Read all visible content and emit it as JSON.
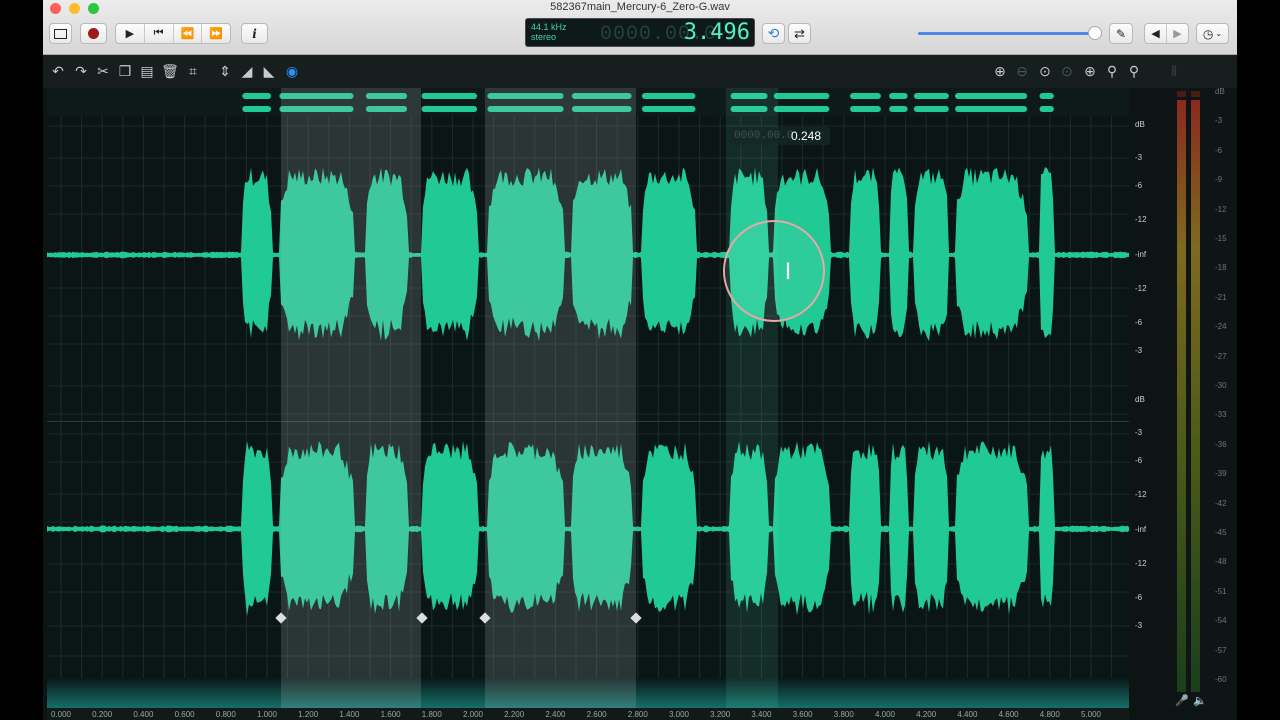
{
  "window": {
    "title": "582367main_Mercury-6_Zero-G.wav"
  },
  "display": {
    "sample_rate": "44.1 kHz",
    "channels": "stereo",
    "time_ghost": "0000.00.0",
    "time_value": "3.496"
  },
  "cursor": {
    "ghost": "0000.00.0",
    "value": "0.248"
  },
  "db_scale": [
    "dB",
    "-3",
    "-6",
    "-12",
    "-inf",
    "-12",
    "-6",
    "-3"
  ],
  "meter_scale": [
    "dB",
    "-3",
    "-6",
    "-9",
    "-12",
    "-15",
    "-18",
    "-21",
    "-24",
    "-27",
    "-30",
    "-33",
    "-36",
    "-39",
    "-42",
    "-45",
    "-48",
    "-51",
    "-54",
    "-57",
    "-60"
  ],
  "ruler": [
    "0.000",
    "0.200",
    "0.400",
    "0.600",
    "0.800",
    "1.000",
    "1.200",
    "1.400",
    "1.600",
    "1.800",
    "2.000",
    "2.200",
    "2.400",
    "2.600",
    "2.800",
    "3.000",
    "3.200",
    "3.400",
    "3.600",
    "3.800",
    "4.000",
    "4.200",
    "4.400",
    "4.600",
    "4.800",
    "5.000"
  ],
  "waveform": {
    "color": "#21c995",
    "duration_s": 5.2,
    "bursts_s": [
      [
        0.88,
        1.02
      ],
      [
        1.06,
        1.42
      ],
      [
        1.48,
        1.68
      ],
      [
        1.75,
        2.02
      ],
      [
        2.07,
        2.44
      ],
      [
        2.48,
        2.77
      ],
      [
        2.82,
        3.08
      ],
      [
        3.25,
        3.43
      ],
      [
        3.46,
        3.73
      ],
      [
        3.83,
        3.98
      ],
      [
        4.02,
        4.11
      ],
      [
        4.14,
        4.31
      ],
      [
        4.34,
        4.69
      ],
      [
        4.75,
        4.82
      ]
    ],
    "selections_s": [
      [
        1.07,
        1.75
      ],
      [
        2.06,
        2.79
      ]
    ],
    "cursor_s": [
      3.23,
      3.48
    ]
  },
  "colors": {
    "accent": "#4a87e8",
    "lcd": "#54f0c4",
    "selection": "#c8d2d2"
  }
}
